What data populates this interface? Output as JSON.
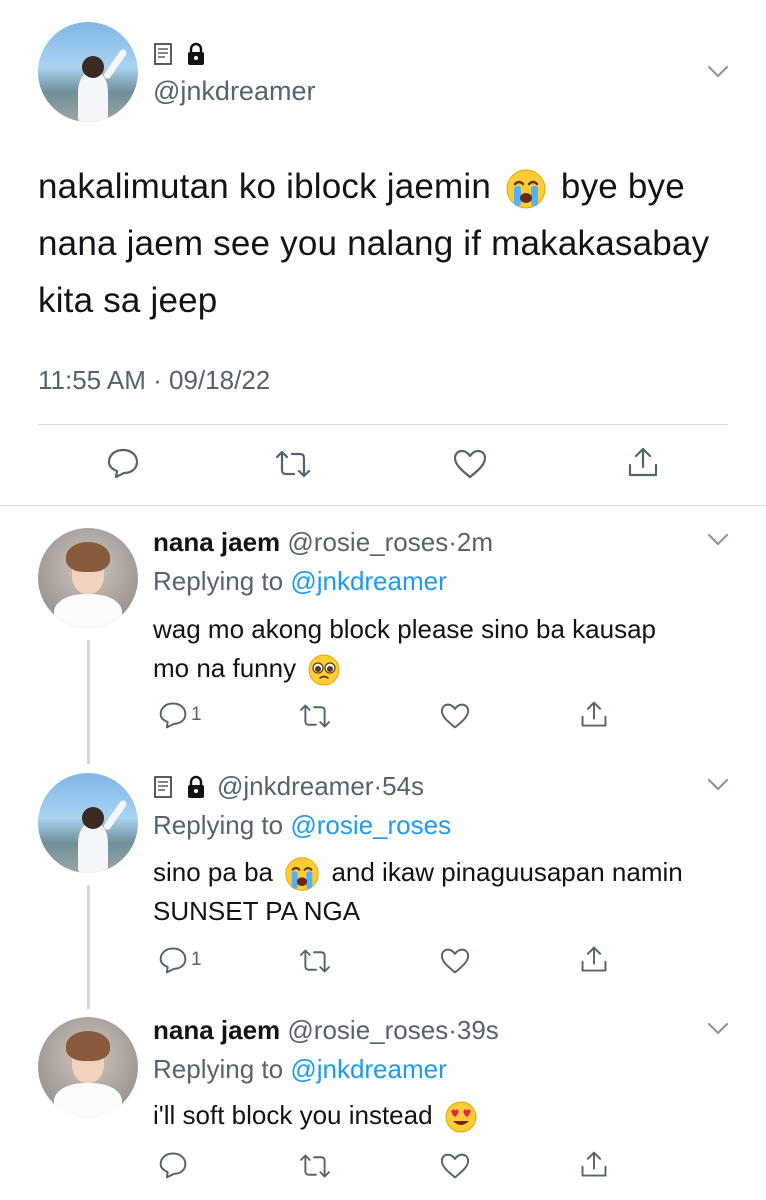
{
  "main_tweet": {
    "handle": "@jnkdreamer",
    "badges": [
      "scroll-icon",
      "lock-icon"
    ],
    "text_part1": "nakalimutan ko iblock jaemin",
    "text_emoji": "loudly-crying-face",
    "text_part2": "bye bye nana jaem see you nalang if makakasabay kita sa jeep",
    "timestamp": "11:55 AM · 09/18/22"
  },
  "replies": [
    {
      "name": "nana jaem",
      "handle": "@rosie_roses",
      "age": "2m",
      "replying_prefix": "Replying to",
      "replying_to": "@jnkdreamer",
      "text": "wag mo akong block please sino ba kausap mo na funny",
      "emoji": "pleading-face",
      "reply_count": "1"
    },
    {
      "name": "",
      "handle": "@jnkdreamer",
      "age": "54s",
      "replying_prefix": "Replying to",
      "replying_to": "@rosie_roses",
      "text_a": "sino pa ba",
      "emoji": "loudly-crying-face",
      "text_b": "and ikaw pinaguusapan namin SUNSET PA NGA",
      "reply_count": "1"
    },
    {
      "name": "nana jaem",
      "handle": "@rosie_roses",
      "age": "39s",
      "replying_prefix": "Replying to",
      "replying_to": "@jnkdreamer",
      "text": "i'll soft block you instead",
      "emoji": "heart-eyes-face",
      "reply_count": ""
    }
  ],
  "separator": "·",
  "colors": {
    "link": "#1d9bf0",
    "secondary": "#536471",
    "divider": "#cfd9de",
    "text": "#0f1419"
  }
}
